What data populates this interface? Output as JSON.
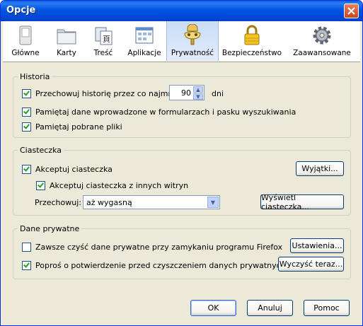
{
  "window": {
    "title": "Opcje"
  },
  "toolbar": {
    "items": [
      {
        "label": "Główne",
        "icon": "switch-icon"
      },
      {
        "label": "Karty",
        "icon": "folder-tabs-icon"
      },
      {
        "label": "Treść",
        "icon": "content-page-icon"
      },
      {
        "label": "Aplikacje",
        "icon": "applications-icon"
      },
      {
        "label": "Prywatność",
        "icon": "privacy-mask-icon",
        "selected": true
      },
      {
        "label": "Bezpieczeństwo",
        "icon": "padlock-icon"
      },
      {
        "label": "Zaawansowane",
        "icon": "gear-icon"
      }
    ]
  },
  "history": {
    "title": "Historia",
    "keep_label": "Przechowuj historię przez co najmniej",
    "keep_checked": true,
    "days_value": "90",
    "days_unit": "dni",
    "forms_label": "Pamiętaj dane wprowadzone w formularzach i pasku wyszukiwania",
    "forms_checked": true,
    "downloads_label": "Pamiętaj pobrane pliki",
    "downloads_checked": true
  },
  "cookies": {
    "title": "Ciasteczka",
    "accept_label": "Akceptuj ciasteczka",
    "accept_checked": true,
    "exceptions_button": "Wyjątki...",
    "third_party_label": "Akceptuj ciasteczka z innych witryn",
    "third_party_checked": true,
    "keep_label": "Przechowuj:",
    "keep_value": "aż wygasną",
    "show_button": "Wyświetl ciasteczka..."
  },
  "private": {
    "title": "Dane prywatne",
    "clear_on_close_label": "Zawsze czyść dane prywatne przy zamykaniu programu Firefox",
    "clear_on_close_checked": false,
    "settings_button": "Ustawienia...",
    "ask_label": "Poproś o potwierdzenie przed czyszczeniem danych prywatnych",
    "ask_checked": true,
    "clear_now_button": "Wyczyść teraz..."
  },
  "footer": {
    "ok": "OK",
    "cancel": "Anuluj",
    "help": "Pomoc"
  },
  "colors": {
    "titlebar": "#0054e3",
    "dialog_bg": "#ece9d8",
    "close": "#c84622"
  }
}
